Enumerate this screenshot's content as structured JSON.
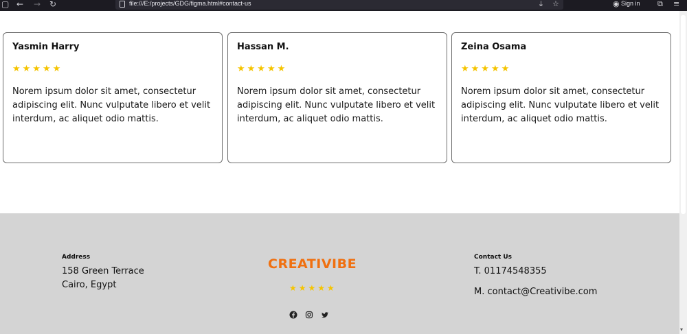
{
  "browser": {
    "url": "file:///E:/projects/GDG/figma.html#contact-us",
    "sign_in_label": "Sign in"
  },
  "reviews": [
    {
      "name": "Yasmin Harry",
      "rating": 5,
      "stars": "★★★★★",
      "text": "Norem ipsum dolor sit amet, consectetur adipiscing elit. Nunc vulputate libero et velit interdum, ac aliquet odio mattis."
    },
    {
      "name": "Hassan M.",
      "rating": 5,
      "stars": "★★★★★",
      "text": "Norem ipsum dolor sit amet, consectetur adipiscing elit. Nunc vulputate libero et velit interdum, ac aliquet odio mattis."
    },
    {
      "name": "Zeina Osama",
      "rating": 5,
      "stars": "★★★★★",
      "text": "Norem ipsum dolor sit amet, consectetur adipiscing elit. Nunc vulputate libero et velit interdum, ac aliquet odio mattis."
    }
  ],
  "footer": {
    "address": {
      "label": "Address",
      "line1": "158 Green Terrace",
      "line2": "Cairo, Egypt"
    },
    "brand": {
      "name": "CREATIVIBE",
      "rating": 5,
      "stars": "★★★★★"
    },
    "contact": {
      "label": "Contact Us",
      "phone": "T. 01174548355",
      "email": "M. contact@Creativibe.com"
    },
    "social_icons": [
      "facebook-icon",
      "instagram-icon",
      "twitter-icon"
    ]
  },
  "colors": {
    "accent": "#f07010",
    "star": "#f5c400",
    "footer_bg": "#d4d4d4"
  }
}
